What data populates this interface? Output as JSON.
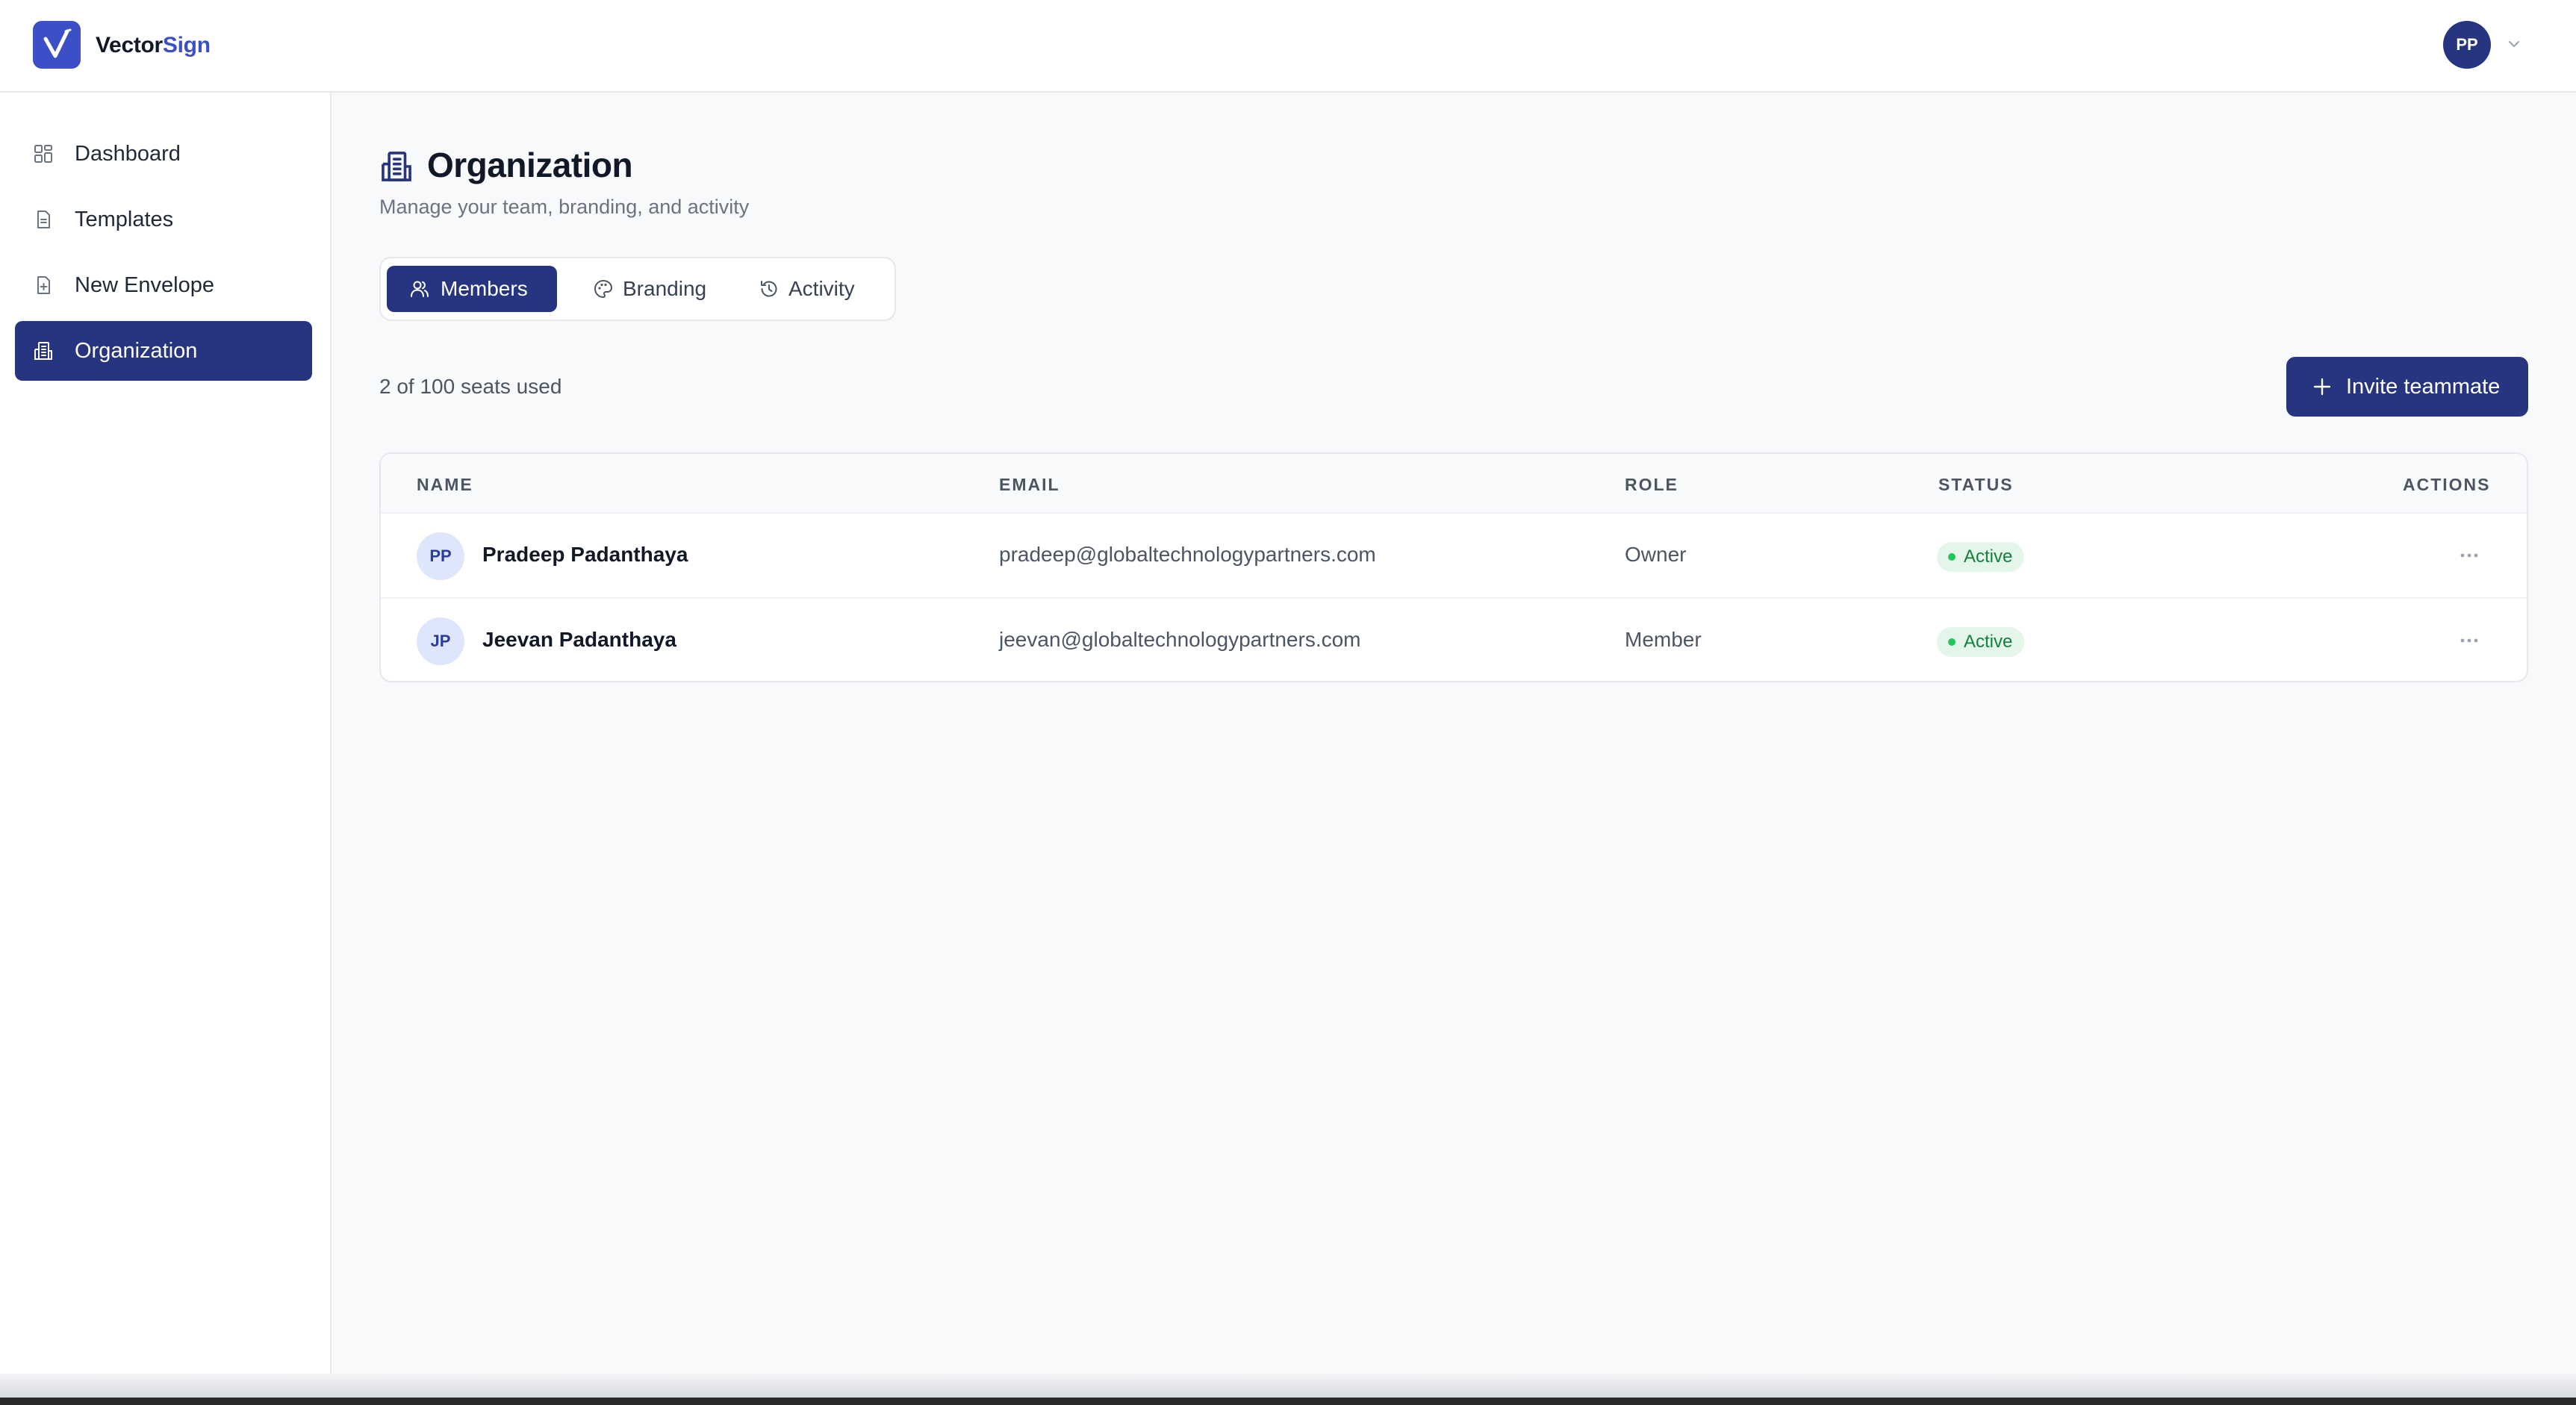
{
  "brand": {
    "part1": "Vector",
    "part2": "Sign",
    "accent_color": "#3d4fc6",
    "primary_color": "#273580"
  },
  "user": {
    "initials": "PP"
  },
  "sidebar": {
    "items": [
      {
        "label": "Dashboard",
        "icon": "dashboard-grid-icon"
      },
      {
        "label": "Templates",
        "icon": "document-icon"
      },
      {
        "label": "New Envelope",
        "icon": "file-plus-icon"
      },
      {
        "label": "Organization",
        "icon": "building-icon",
        "active": true
      }
    ]
  },
  "page": {
    "title": "Organization",
    "subtitle": "Manage your team, branding, and activity"
  },
  "tabs": [
    {
      "label": "Members",
      "icon": "users-icon",
      "active": true
    },
    {
      "label": "Branding",
      "icon": "palette-icon"
    },
    {
      "label": "Activity",
      "icon": "history-icon"
    }
  ],
  "seats_text": "2 of 100 seats used",
  "invite_button": "Invite teammate",
  "table": {
    "columns": [
      "NAME",
      "EMAIL",
      "ROLE",
      "STATUS",
      "ACTIONS"
    ],
    "rows": [
      {
        "initials": "PP",
        "name": "Pradeep Padanthaya",
        "email": "pradeep@globaltechnologypartners.com",
        "role": "Owner",
        "status": "Active"
      },
      {
        "initials": "JP",
        "name": "Jeevan Padanthaya",
        "email": "jeevan@globaltechnologypartners.com",
        "role": "Member",
        "status": "Active"
      }
    ]
  }
}
